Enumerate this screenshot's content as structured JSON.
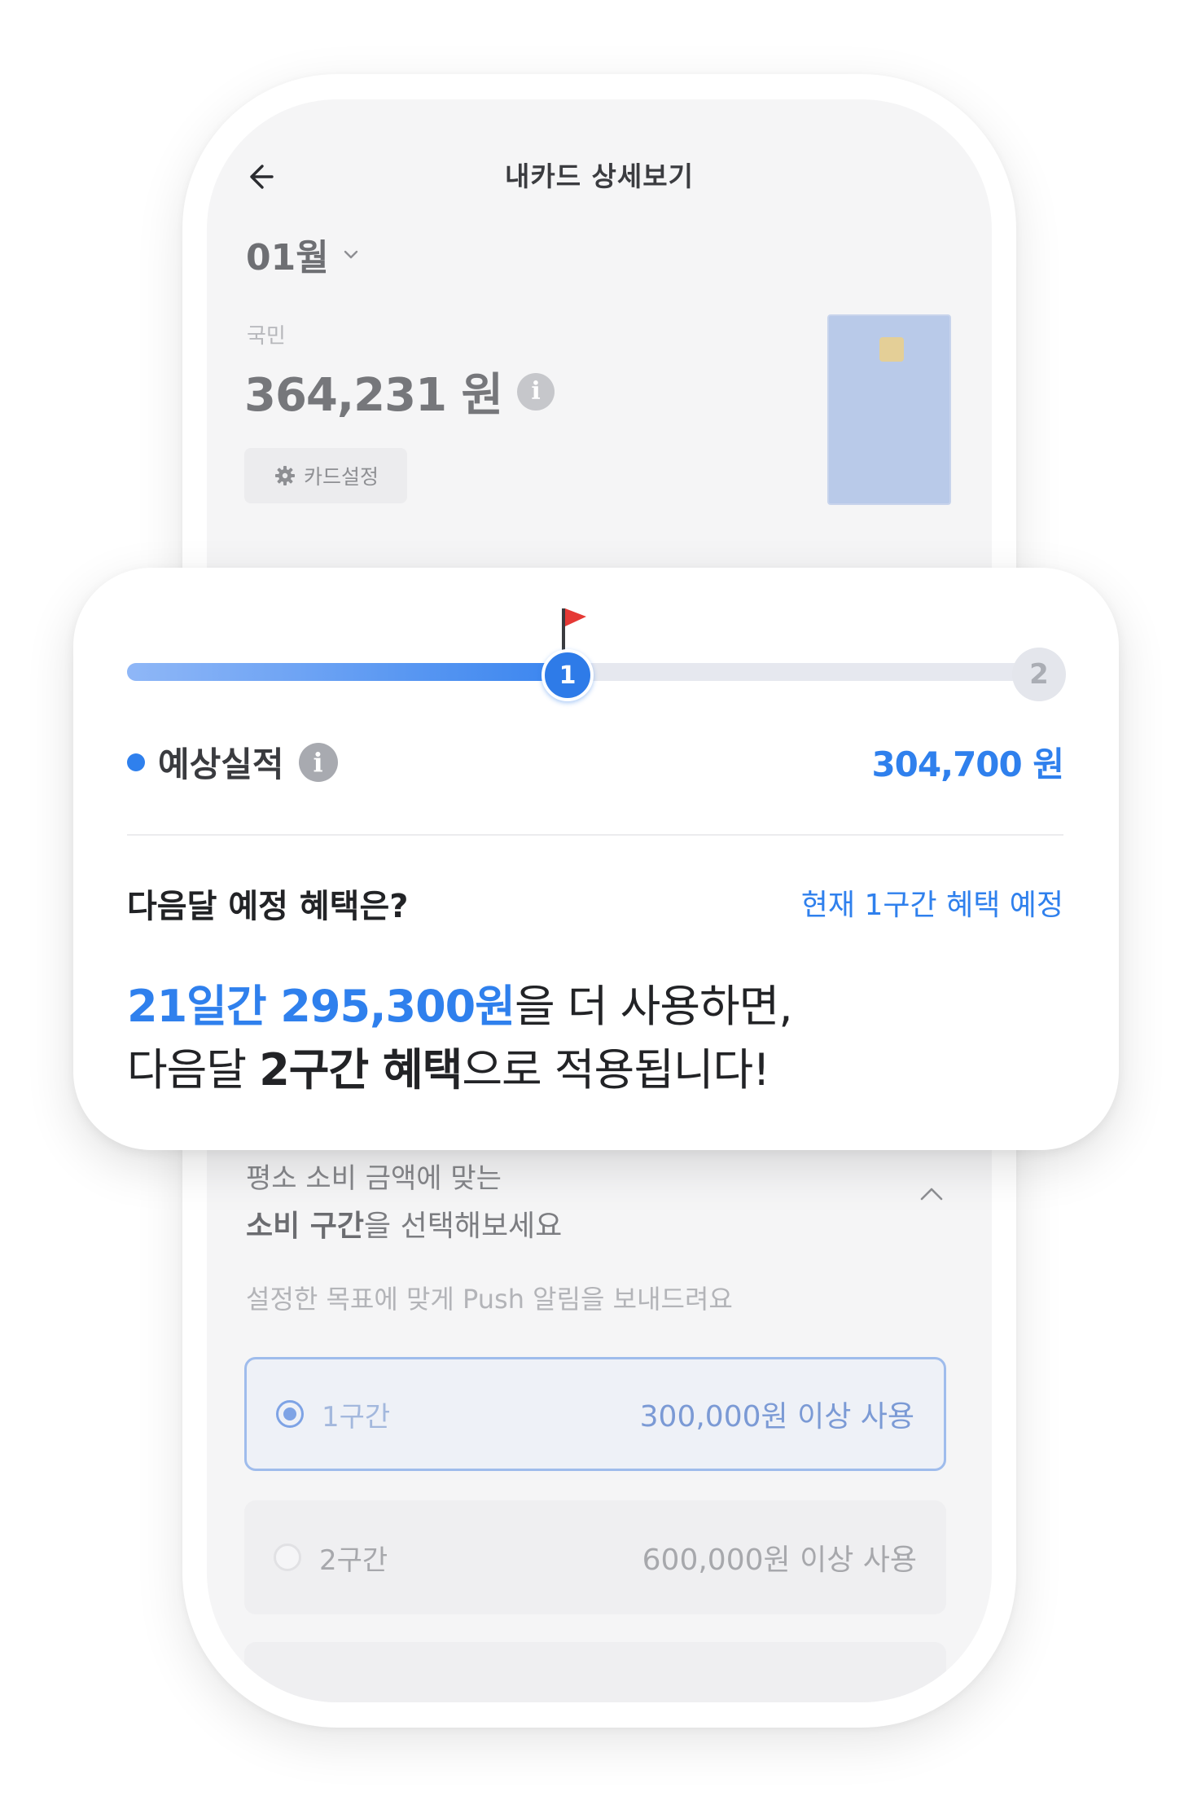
{
  "header": {
    "title": "내카드 상세보기"
  },
  "month": {
    "label": "01월"
  },
  "card": {
    "bank": "국민",
    "amount": "364,231 원",
    "setting_label": "카드설정",
    "color": "#b9cae9"
  },
  "progress": {
    "current_tier_node": "1",
    "next_tier_node": "2",
    "fill_fraction": 0.47,
    "expected_label": "예상실적",
    "expected_amount": "304,700 원"
  },
  "benefit": {
    "question": "다음달 예정 혜택은?",
    "current_tier": "현재 1구간 혜택 예정",
    "msg_highlight": "21일간 295,300원",
    "msg_line1_rest": "을 더 사용하면,",
    "msg_line2_a": "다음달 ",
    "msg_line2_bold": "2구간 혜택",
    "msg_line2_b": "으로 적용됩니다!"
  },
  "goal": {
    "line1": "평소 소비 금액에 맞는",
    "line2_bold": "소비 구간",
    "line2_rest": "을 선택해보세요",
    "push_note": "설정한 목표에 맞게 Push 알림을 보내드려요",
    "options": [
      {
        "label": "1구간",
        "amount": "300,000원 이상 사용",
        "selected": true
      },
      {
        "label": "2구간",
        "amount": "600,000원 이상 사용",
        "selected": false
      }
    ]
  },
  "colors": {
    "accent": "#2f80ed",
    "flag": "#e53935"
  }
}
